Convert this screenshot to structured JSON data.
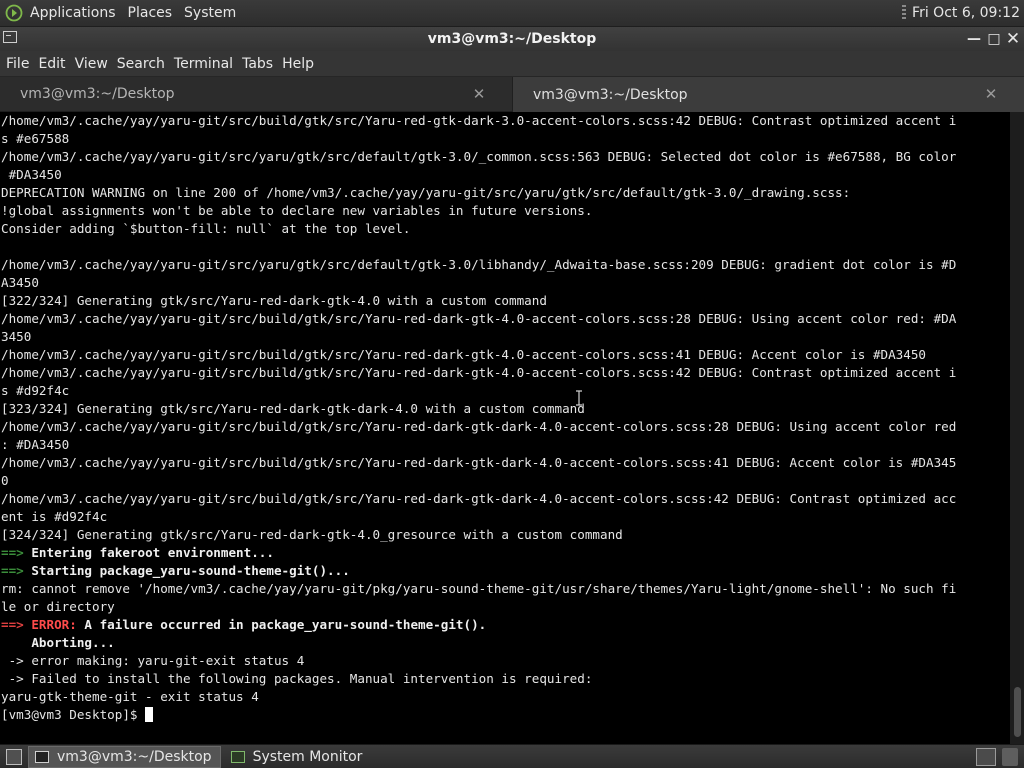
{
  "top_panel": {
    "menus": [
      "Applications",
      "Places",
      "System"
    ],
    "clock": "Fri Oct  6, 09:12"
  },
  "window": {
    "title": "vm3@vm3:~/Desktop",
    "controls": [
      "minimize",
      "maximize",
      "close"
    ]
  },
  "menubar": [
    "File",
    "Edit",
    "View",
    "Search",
    "Terminal",
    "Tabs",
    "Help"
  ],
  "tabs": [
    {
      "label": "vm3@vm3:~/Desktop",
      "active": false
    },
    {
      "label": "vm3@vm3:~/Desktop",
      "active": true
    }
  ],
  "terminal": {
    "lines": [
      {
        "text": "/home/vm3/.cache/yay/yaru-git/src/build/gtk/src/Yaru-red-gtk-dark-3.0-accent-colors.scss:42 DEBUG: Contrast optimized accent i"
      },
      {
        "text": "s #e67588"
      },
      {
        "text": "/home/vm3/.cache/yay/yaru-git/src/yaru/gtk/src/default/gtk-3.0/_common.scss:563 DEBUG: Selected dot color is #e67588, BG color"
      },
      {
        "text": " #DA3450"
      },
      {
        "text": "DEPRECATION WARNING on line 200 of /home/vm3/.cache/yay/yaru-git/src/yaru/gtk/src/default/gtk-3.0/_drawing.scss:"
      },
      {
        "text": "!global assignments won't be able to declare new variables in future versions."
      },
      {
        "text": "Consider adding `$button-fill: null` at the top level."
      },
      {
        "text": ""
      },
      {
        "text": "/home/vm3/.cache/yay/yaru-git/src/yaru/gtk/src/default/gtk-3.0/libhandy/_Adwaita-base.scss:209 DEBUG: gradient dot color is #D"
      },
      {
        "text": "A3450"
      },
      {
        "text": "[322/324] Generating gtk/src/Yaru-red-dark-gtk-4.0 with a custom command"
      },
      {
        "text": "/home/vm3/.cache/yay/yaru-git/src/build/gtk/src/Yaru-red-dark-gtk-4.0-accent-colors.scss:28 DEBUG: Using accent color red: #DA"
      },
      {
        "text": "3450"
      },
      {
        "text": "/home/vm3/.cache/yay/yaru-git/src/build/gtk/src/Yaru-red-dark-gtk-4.0-accent-colors.scss:41 DEBUG: Accent color is #DA3450"
      },
      {
        "text": "/home/vm3/.cache/yay/yaru-git/src/build/gtk/src/Yaru-red-dark-gtk-4.0-accent-colors.scss:42 DEBUG: Contrast optimized accent i"
      },
      {
        "text": "s #d92f4c"
      },
      {
        "text": "[323/324] Generating gtk/src/Yaru-red-dark-gtk-dark-4.0 with a custom command"
      },
      {
        "text": "/home/vm3/.cache/yay/yaru-git/src/build/gtk/src/Yaru-red-dark-gtk-dark-4.0-accent-colors.scss:28 DEBUG: Using accent color red"
      },
      {
        "text": ": #DA3450"
      },
      {
        "text": "/home/vm3/.cache/yay/yaru-git/src/build/gtk/src/Yaru-red-dark-gtk-dark-4.0-accent-colors.scss:41 DEBUG: Accent color is #DA345"
      },
      {
        "text": "0"
      },
      {
        "text": "/home/vm3/.cache/yay/yaru-git/src/build/gtk/src/Yaru-red-dark-gtk-dark-4.0-accent-colors.scss:42 DEBUG: Contrast optimized acc"
      },
      {
        "text": "ent is #d92f4c"
      },
      {
        "text": "[324/324] Generating gtk/src/Yaru-red-dark-gtk-4.0_gresource with a custom command"
      },
      {
        "prefix": "==>",
        "prefix_style": "arrow",
        "text": " Entering fakeroot environment...",
        "bold": true
      },
      {
        "prefix": "==>",
        "prefix_style": "arrow",
        "text": " Starting package_yaru-sound-theme-git()...",
        "bold": true
      },
      {
        "text": "rm: cannot remove '/home/vm3/.cache/yay/yaru-git/pkg/yaru-sound-theme-git/usr/share/themes/Yaru-light/gnome-shell': No such fi"
      },
      {
        "text": "le or directory"
      },
      {
        "prefix": "==> ERROR:",
        "prefix_style": "error",
        "text": " A failure occurred in package_yaru-sound-theme-git().",
        "bold": true
      },
      {
        "text": "    Aborting...",
        "bold": true
      },
      {
        "text": " -> error making: yaru-git-exit status 4"
      },
      {
        "text": " -> Failed to install the following packages. Manual intervention is required:"
      },
      {
        "text": "yaru-gtk-theme-git - exit status 4"
      }
    ],
    "prompt": "[vm3@vm3 Desktop]$ "
  },
  "taskbar": {
    "tasks": [
      {
        "label": "vm3@vm3:~/Desktop",
        "icon": "terminal-icon",
        "active": true
      },
      {
        "label": "System Monitor",
        "icon": "system-monitor-icon",
        "active": false
      }
    ]
  },
  "colors": {
    "terminal_bg": "#000000",
    "arrow_green": "#3b8e3b",
    "error_red": "#ff4b4b"
  }
}
